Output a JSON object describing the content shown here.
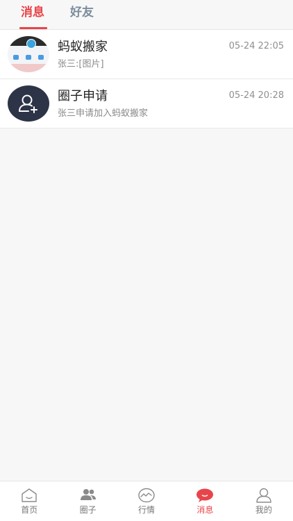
{
  "tabs": [
    {
      "label": "消息",
      "active": true
    },
    {
      "label": "好友",
      "active": false
    }
  ],
  "conversations": [
    {
      "title": "蚂蚁搬家",
      "subtitle": "张三:[图片]",
      "time": "05-24 22:05",
      "avatar": "app-thumbnail"
    },
    {
      "title": "圈子申请",
      "subtitle": "张三申请加入蚂蚁搬家",
      "time": "05-24 20:28",
      "avatar": "add-user-icon"
    }
  ],
  "bottom_nav": [
    {
      "label": "首页",
      "icon": "home-icon",
      "active": false
    },
    {
      "label": "圈子",
      "icon": "group-icon",
      "active": false
    },
    {
      "label": "行情",
      "icon": "trend-icon",
      "active": false
    },
    {
      "label": "消息",
      "icon": "chat-bubble-icon",
      "active": true
    },
    {
      "label": "我的",
      "icon": "profile-icon",
      "active": false
    }
  ],
  "colors": {
    "accent": "#e8454a",
    "inactive_tab": "#7c8c9c",
    "background": "#f7f7f7"
  }
}
